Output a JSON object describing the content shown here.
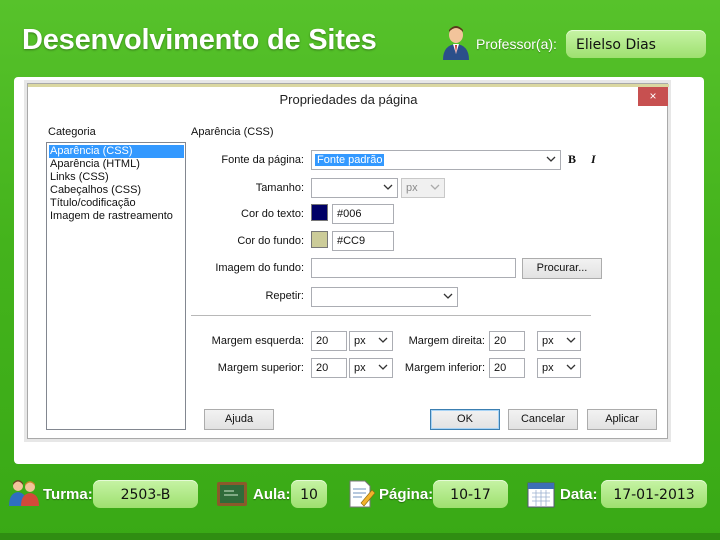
{
  "header": {
    "title": "Desenvolvimento de Sites",
    "professor_label": "Professor(a):",
    "professor_name": "Elielso Dias"
  },
  "dialog": {
    "title": "Propriedades da página",
    "close": "×",
    "category_label": "Categoria",
    "categories": [
      "Aparência (CSS)",
      "Aparência (HTML)",
      "Links (CSS)",
      "Cabeçalhos (CSS)",
      "Título/codificação",
      "Imagem de rastreamento"
    ],
    "selected_category": "Aparência (CSS)",
    "section_label": "Aparência (CSS)",
    "fields": {
      "font_label": "Fonte da página:",
      "font_value": "Fonte padrão",
      "bold": "B",
      "italic": "I",
      "size_label": "Tamanho:",
      "size_value": "",
      "size_unit": "px",
      "text_color_label": "Cor do texto:",
      "text_color_value": "#006",
      "bg_color_label": "Cor do fundo:",
      "bg_color_value": "#CC9",
      "bg_image_label": "Imagem do fundo:",
      "bg_image_value": "",
      "browse": "Procurar...",
      "repeat_label": "Repetir:",
      "repeat_value": "",
      "margin_left_label": "Margem esquerda:",
      "margin_left_value": "20",
      "margin_left_unit": "px",
      "margin_right_label": "Margem direita:",
      "margin_right_value": "20",
      "margin_right_unit": "px",
      "margin_top_label": "Margem superior:",
      "margin_top_value": "20",
      "margin_top_unit": "px",
      "margin_bottom_label": "Margem inferior:",
      "margin_bottom_value": "20",
      "margin_bottom_unit": "px"
    },
    "buttons": {
      "help": "Ajuda",
      "ok": "OK",
      "cancel": "Cancelar",
      "apply": "Aplicar"
    }
  },
  "footer": {
    "turma_label": "Turma:",
    "turma_value": "2503-B",
    "aula_label": "Aula:",
    "aula_value": "10",
    "pagina_label": "Página:",
    "pagina_value": "10-17",
    "data_label": "Data:",
    "data_value": "17-01-2013"
  },
  "colors": {
    "background_green": "#46b41d",
    "pill_green": "#b3ea8a",
    "selection_blue": "#3399ff",
    "text_color_swatch": "#000066",
    "bg_color_swatch": "#cccc99",
    "close_red": "#c75050"
  },
  "icons": [
    "professor-icon",
    "students-icon",
    "chalkboard-icon",
    "page-edit-icon",
    "calendar-icon",
    "chevron-down-icon"
  ]
}
